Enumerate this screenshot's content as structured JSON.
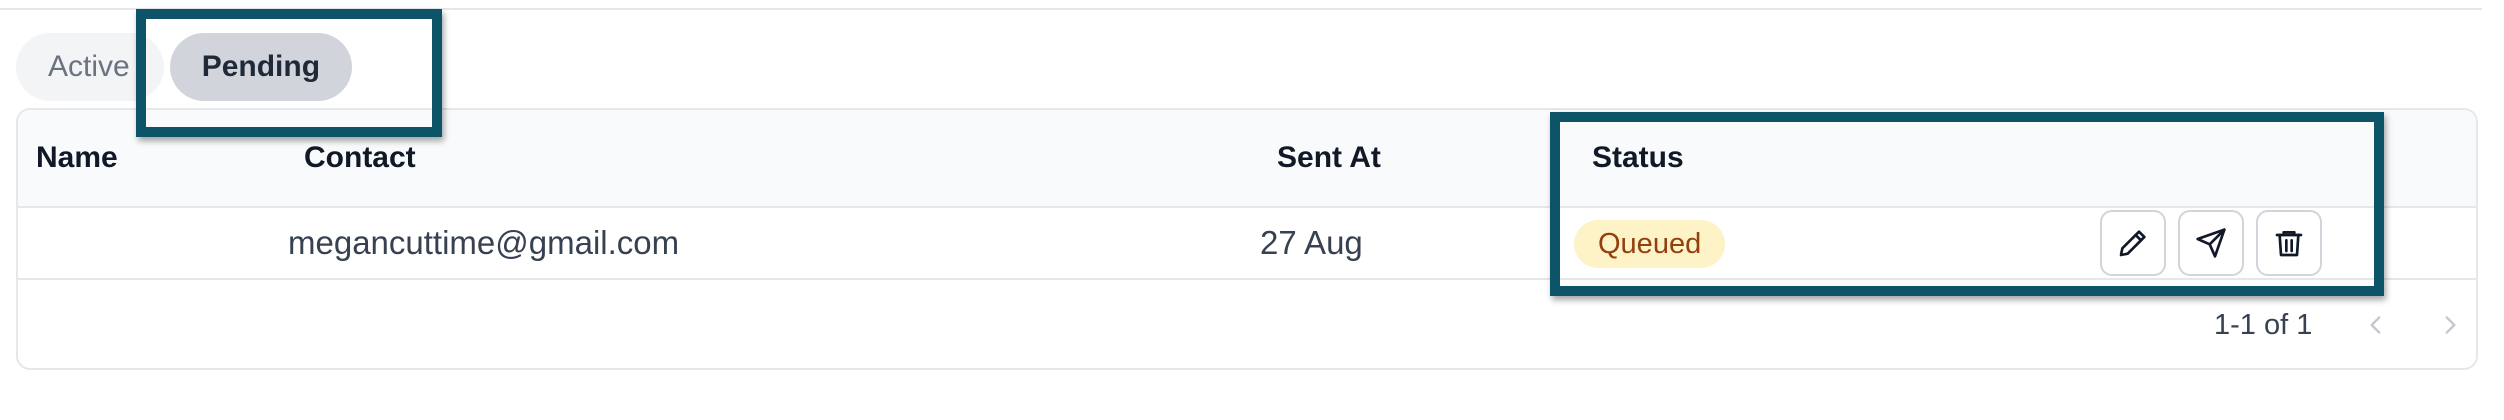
{
  "tabs": [
    {
      "label": "Active",
      "selected": false
    },
    {
      "label": "Pending",
      "selected": true
    }
  ],
  "table": {
    "columns": [
      "Name",
      "Contact",
      "Sent At",
      "Status"
    ],
    "rows": [
      {
        "name": "",
        "contact": "megancuttime@gmail.com",
        "sent_at": "27 Aug",
        "status": "Queued",
        "actions": [
          "pencil-icon",
          "send-icon",
          "trash-icon"
        ]
      }
    ]
  },
  "pagination": {
    "range_text": "1-1 of 1"
  },
  "colors": {
    "highlight": "#0d5468",
    "status_queued_bg": "#fef3c7",
    "status_queued_text": "#92400e"
  }
}
